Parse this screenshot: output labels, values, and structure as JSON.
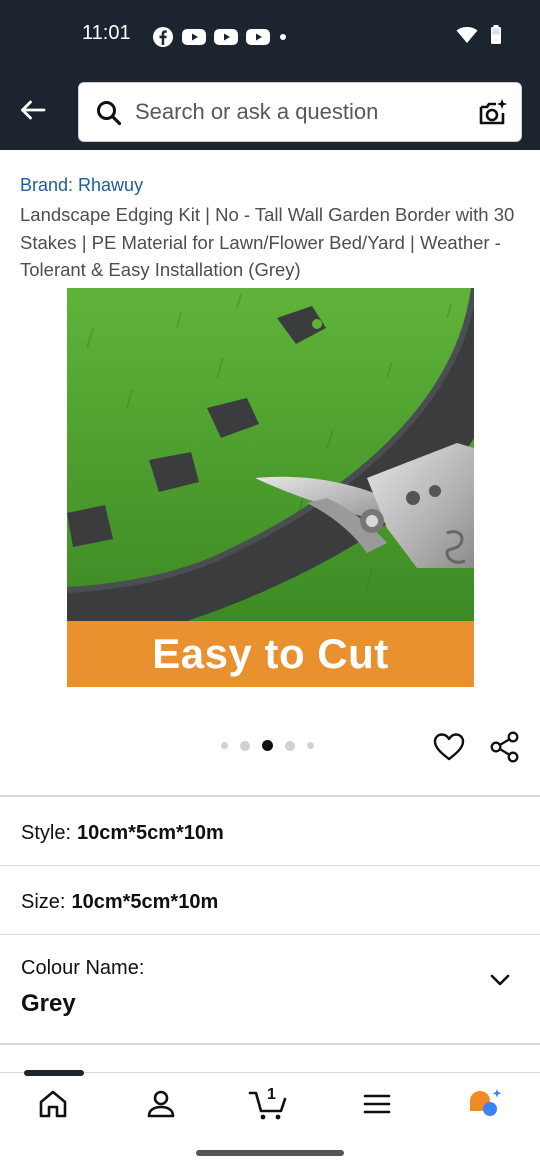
{
  "status_bar": {
    "time": "11:01",
    "notification_icons": [
      "facebook-icon",
      "youtube-icon",
      "youtube-icon",
      "youtube-icon",
      "more-dot-icon"
    ],
    "system_icons": [
      "wifi-icon",
      "battery-icon"
    ]
  },
  "header": {
    "back_icon": "arrow-left-icon",
    "search_placeholder": "Search or ask a question",
    "camera_icon": "camera-search-icon"
  },
  "product": {
    "brand": "Brand: Rhawuy",
    "title": "Landscape Edging Kit | No - Tall Wall Garden Border with 30 Stakes | PE Material for Lawn/Flower Bed/Yard | Weather - Tolerant & Easy Installation (Grey)",
    "image_banner": "Easy to Cut",
    "image_count": 5,
    "active_image_index": 2
  },
  "actions": {
    "wishlist_icon": "heart-icon",
    "share_icon": "share-icon"
  },
  "options": {
    "style_label": "Style:",
    "style_value": "10cm*5cm*10m",
    "size_label": "Size:",
    "size_value": "10cm*5cm*10m",
    "colour_label": "Colour Name:",
    "colour_value": "Grey"
  },
  "bottom_nav": {
    "items": [
      "home-icon",
      "account-icon",
      "cart-icon",
      "menu-icon",
      "rufus-icon"
    ],
    "cart_count": "1"
  },
  "colors": {
    "header_bg": "#1c2430",
    "brand_link": "#1f5c99",
    "banner": "#e8912e"
  }
}
